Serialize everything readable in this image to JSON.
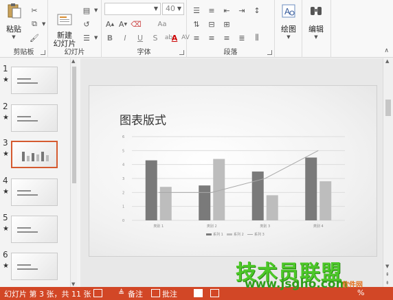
{
  "ribbon": {
    "clipboard": {
      "paste_label": "粘贴",
      "group_label": "剪贴板"
    },
    "slides": {
      "new_slide_label": "新建\n幻灯片",
      "group_label": "幻灯片"
    },
    "font": {
      "font_name": "",
      "font_size": "40",
      "group_label": "字体",
      "bold": "B",
      "italic": "I",
      "underline": "U",
      "strike": "S",
      "spacing": "abc",
      "shadow": "AV",
      "caseA": "Aa"
    },
    "paragraph": {
      "group_label": "段落"
    },
    "drawing": {
      "label": "绘图"
    },
    "editing": {
      "label": "编辑"
    }
  },
  "thumbnails": [
    {
      "num": "1",
      "star": "★",
      "title": ""
    },
    {
      "num": "2",
      "star": "★",
      "title": ""
    },
    {
      "num": "3",
      "star": "★",
      "title": ""
    },
    {
      "num": "4",
      "star": "★",
      "title": ""
    },
    {
      "num": "5",
      "star": "★",
      "title": ""
    },
    {
      "num": "6",
      "star": "★",
      "title": ""
    }
  ],
  "slide": {
    "title": "图表版式"
  },
  "chart_data": {
    "type": "bar",
    "categories": [
      "类别 1",
      "类别 2",
      "类别 3",
      "类别 4"
    ],
    "series": [
      {
        "name": "系列 1",
        "values": [
          4.3,
          2.5,
          3.5,
          4.5
        ],
        "color": "#7a7a7a",
        "kind": "bar"
      },
      {
        "name": "系列 2",
        "values": [
          2.4,
          4.4,
          1.8,
          2.8
        ],
        "color": "#bdbdbd",
        "kind": "bar"
      },
      {
        "name": "系列 3",
        "values": [
          2,
          2,
          3,
          5
        ],
        "color": "#a8a8a8",
        "kind": "line"
      }
    ],
    "yticks": [
      "0",
      "1",
      "2",
      "3",
      "4",
      "5",
      "6"
    ],
    "ylim": [
      0,
      6
    ],
    "legend": "bottom"
  },
  "status": {
    "slide_info": "幻灯片 第 3 张，共 11 张",
    "notes": "备注",
    "comments": "批注",
    "zoom": "%"
  },
  "watermark": {
    "text": "技术员联盟",
    "url": "www.jsgho.com",
    "logo": "软件网"
  },
  "colors": {
    "accent": "#d24726",
    "selected_thumb": "#d55a2f",
    "watermark": "#4cc728"
  }
}
